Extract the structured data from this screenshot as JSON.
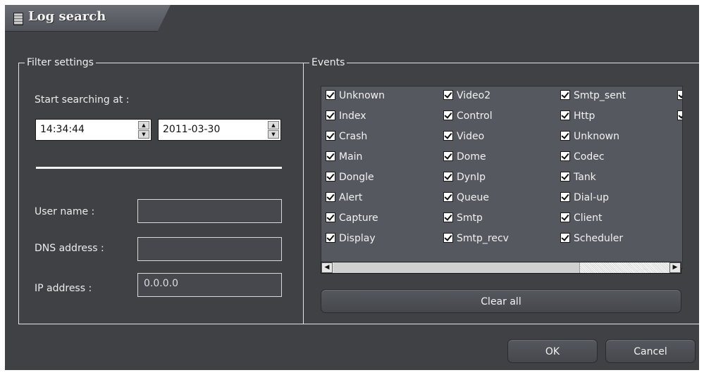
{
  "window": {
    "title": "Log search"
  },
  "filter": {
    "group_label": "Filter settings",
    "start_label": "Start searching at :",
    "time_value": "14:34:44",
    "date_value": "2011-03-30",
    "user_label": "User name :",
    "user_value": "",
    "dns_label": "DNS address :",
    "dns_value": "",
    "ip_label": "IP address :",
    "ip_value": "0.0.0.0"
  },
  "events": {
    "group_label": "Events",
    "items": [
      {
        "label": "Unknown",
        "checked": true
      },
      {
        "label": "Index",
        "checked": true
      },
      {
        "label": "Crash",
        "checked": true
      },
      {
        "label": "Main",
        "checked": true
      },
      {
        "label": "Dongle",
        "checked": true
      },
      {
        "label": "Alert",
        "checked": true
      },
      {
        "label": "Capture",
        "checked": true
      },
      {
        "label": "Display",
        "checked": true
      },
      {
        "label": "Video2",
        "checked": true
      },
      {
        "label": "Control",
        "checked": true
      },
      {
        "label": "Video",
        "checked": true
      },
      {
        "label": "Dome",
        "checked": true
      },
      {
        "label": "DynIp",
        "checked": true
      },
      {
        "label": "Queue",
        "checked": true
      },
      {
        "label": "Smtp",
        "checked": true
      },
      {
        "label": "Smtp_recv",
        "checked": true
      },
      {
        "label": "Smtp_sent",
        "checked": true
      },
      {
        "label": "Http",
        "checked": true
      },
      {
        "label": "Unknown",
        "checked": true
      },
      {
        "label": "Codec",
        "checked": true
      },
      {
        "label": "Tank",
        "checked": true
      },
      {
        "label": "Dial-up",
        "checked": true
      },
      {
        "label": "Client",
        "checked": true
      },
      {
        "label": "Scheduler",
        "checked": true
      }
    ],
    "clear_label": "Clear all"
  },
  "buttons": {
    "ok": "OK",
    "cancel": "Cancel"
  }
}
